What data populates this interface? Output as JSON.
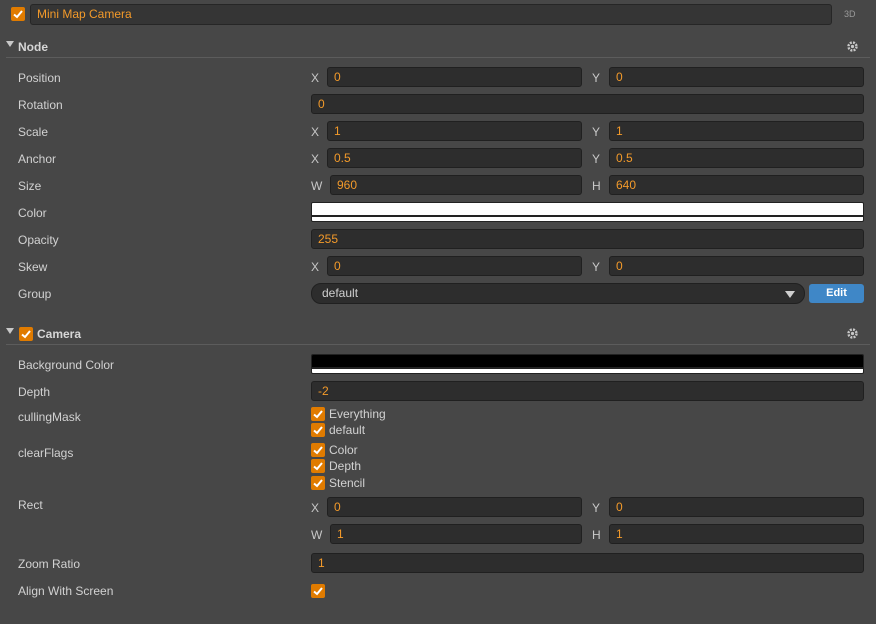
{
  "header": {
    "enabled": true,
    "node_name": "Mini Map Camera",
    "mode_tag": "3D"
  },
  "node": {
    "title": "Node",
    "position": {
      "label": "Position",
      "x_label": "X",
      "x": "0",
      "y_label": "Y",
      "y": "0"
    },
    "rotation": {
      "label": "Rotation",
      "value": "0"
    },
    "scale": {
      "label": "Scale",
      "x_label": "X",
      "x": "1",
      "y_label": "Y",
      "y": "1"
    },
    "anchor": {
      "label": "Anchor",
      "x_label": "X",
      "x": "0.5",
      "y_label": "Y",
      "y": "0.5"
    },
    "size": {
      "label": "Size",
      "w_label": "W",
      "w": "960",
      "h_label": "H",
      "h": "640"
    },
    "color": {
      "label": "Color",
      "value": "#ffffff"
    },
    "opacity": {
      "label": "Opacity",
      "value": "255"
    },
    "skew": {
      "label": "Skew",
      "x_label": "X",
      "x": "0",
      "y_label": "Y",
      "y": "0"
    },
    "group": {
      "label": "Group",
      "value": "default",
      "edit_label": "Edit"
    }
  },
  "camera": {
    "title": "Camera",
    "enabled": true,
    "background_color": {
      "label": "Background Color",
      "value": "#000000"
    },
    "depth": {
      "label": "Depth",
      "value": "-2"
    },
    "culling_mask": {
      "label": "cullingMask",
      "options": [
        {
          "label": "Everything",
          "checked": true
        },
        {
          "label": "default",
          "checked": true
        }
      ]
    },
    "clear_flags": {
      "label": "clearFlags",
      "options": [
        {
          "label": "Color",
          "checked": true
        },
        {
          "label": "Depth",
          "checked": true
        },
        {
          "label": "Stencil",
          "checked": true
        }
      ]
    },
    "rect": {
      "label": "Rect",
      "x_label": "X",
      "x": "0",
      "y_label": "Y",
      "y": "0",
      "w_label": "W",
      "w": "1",
      "h_label": "H",
      "h": "1"
    },
    "zoom_ratio": {
      "label": "Zoom Ratio",
      "value": "1"
    },
    "align_with_screen": {
      "label": "Align With Screen",
      "checked": true
    }
  },
  "colors": {
    "accent": "#e07b00",
    "value_text": "#f39a2a",
    "button": "#3f87c7",
    "background": "#474747"
  }
}
